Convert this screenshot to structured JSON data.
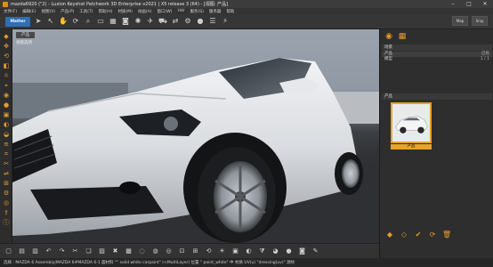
{
  "window": {
    "title": "mazda6920 (\"2) - Luxion Keyshot Patchwork 3D Enterprise v2021 | X5 release 3 (64) - [视图: 产品]",
    "controls": [
      "–",
      "□",
      "✕"
    ]
  },
  "menu": [
    "文件(F)",
    "编辑(E)",
    "视图(V)",
    "产品(P)",
    "工具(T)",
    "帮助(H)",
    "材质(M)",
    "动画(A)",
    "窗口(W)",
    "Hdr",
    "服务(S)",
    "服务器",
    "帮助"
  ],
  "toolbar": {
    "mode_label": "Matter",
    "icons": [
      "cursor-icon",
      "arrow-icon",
      "hand-icon",
      "rotate-icon",
      "zoom-icon",
      "rectangle-icon",
      "grid-icon",
      "camera-icon",
      "light-icon",
      "aircraft-icon",
      "car-icon",
      "arrows-icon",
      "gear-icon",
      "sphere-icon",
      "layers-icon",
      "bolt-icon"
    ],
    "right_labels": [
      "Map",
      "Srsp"
    ]
  },
  "viewport": {
    "tab": "产品",
    "label": "视窗选项"
  },
  "leftbar": {
    "icons": [
      "select-icon",
      "move-icon",
      "rotate-icon",
      "scale-icon",
      "light-icon",
      "snap-icon",
      "camera-icon",
      "record-icon",
      "render-icon",
      "material-icon",
      "environment-icon",
      "layer-icon",
      "tag-icon",
      "clip-icon",
      "mirror-icon",
      "measure-icon",
      "settings-icon",
      "keyshot-icon",
      "export-icon",
      "info-icon"
    ]
  },
  "bottombar": {
    "icons": [
      "new-icon",
      "open-icon",
      "save-icon",
      "undo-icon",
      "redo-icon",
      "cut-icon",
      "copy-icon",
      "paste-icon",
      "delete-icon",
      "group-icon",
      "hide-icon",
      "show-icon",
      "isolate-icon",
      "fit-icon",
      "frame-icon",
      "reset-icon",
      "light-icon",
      "render-icon",
      "material-icon",
      "filter-icon",
      "color-icon",
      "sphere-icon",
      "camera-icon",
      "script-icon"
    ]
  },
  "status": {
    "text": "选择 : MAZDA 6 Assembly|MAZDA 6#MAZDA 6-1 面材料 \"\" solid white carpaint\" (<MultiLayer) 位置 \" paint_white\" 中 材质 UV(u) \"dressing(uv)\" 源纹"
  },
  "rightpanel": {
    "tabs": [
      "view-tab-icon",
      "camera-tab-icon"
    ],
    "section1": "场景",
    "rows": [
      {
        "label": "产品",
        "value": "已有"
      },
      {
        "label": "模型",
        "value": "1 / 1"
      }
    ],
    "section2": "产品",
    "thumbnail_label": "产品",
    "actions": [
      "diamond-icon",
      "diamond-outline-icon",
      "check-icon",
      "refresh-icon",
      "trash-icon"
    ]
  }
}
